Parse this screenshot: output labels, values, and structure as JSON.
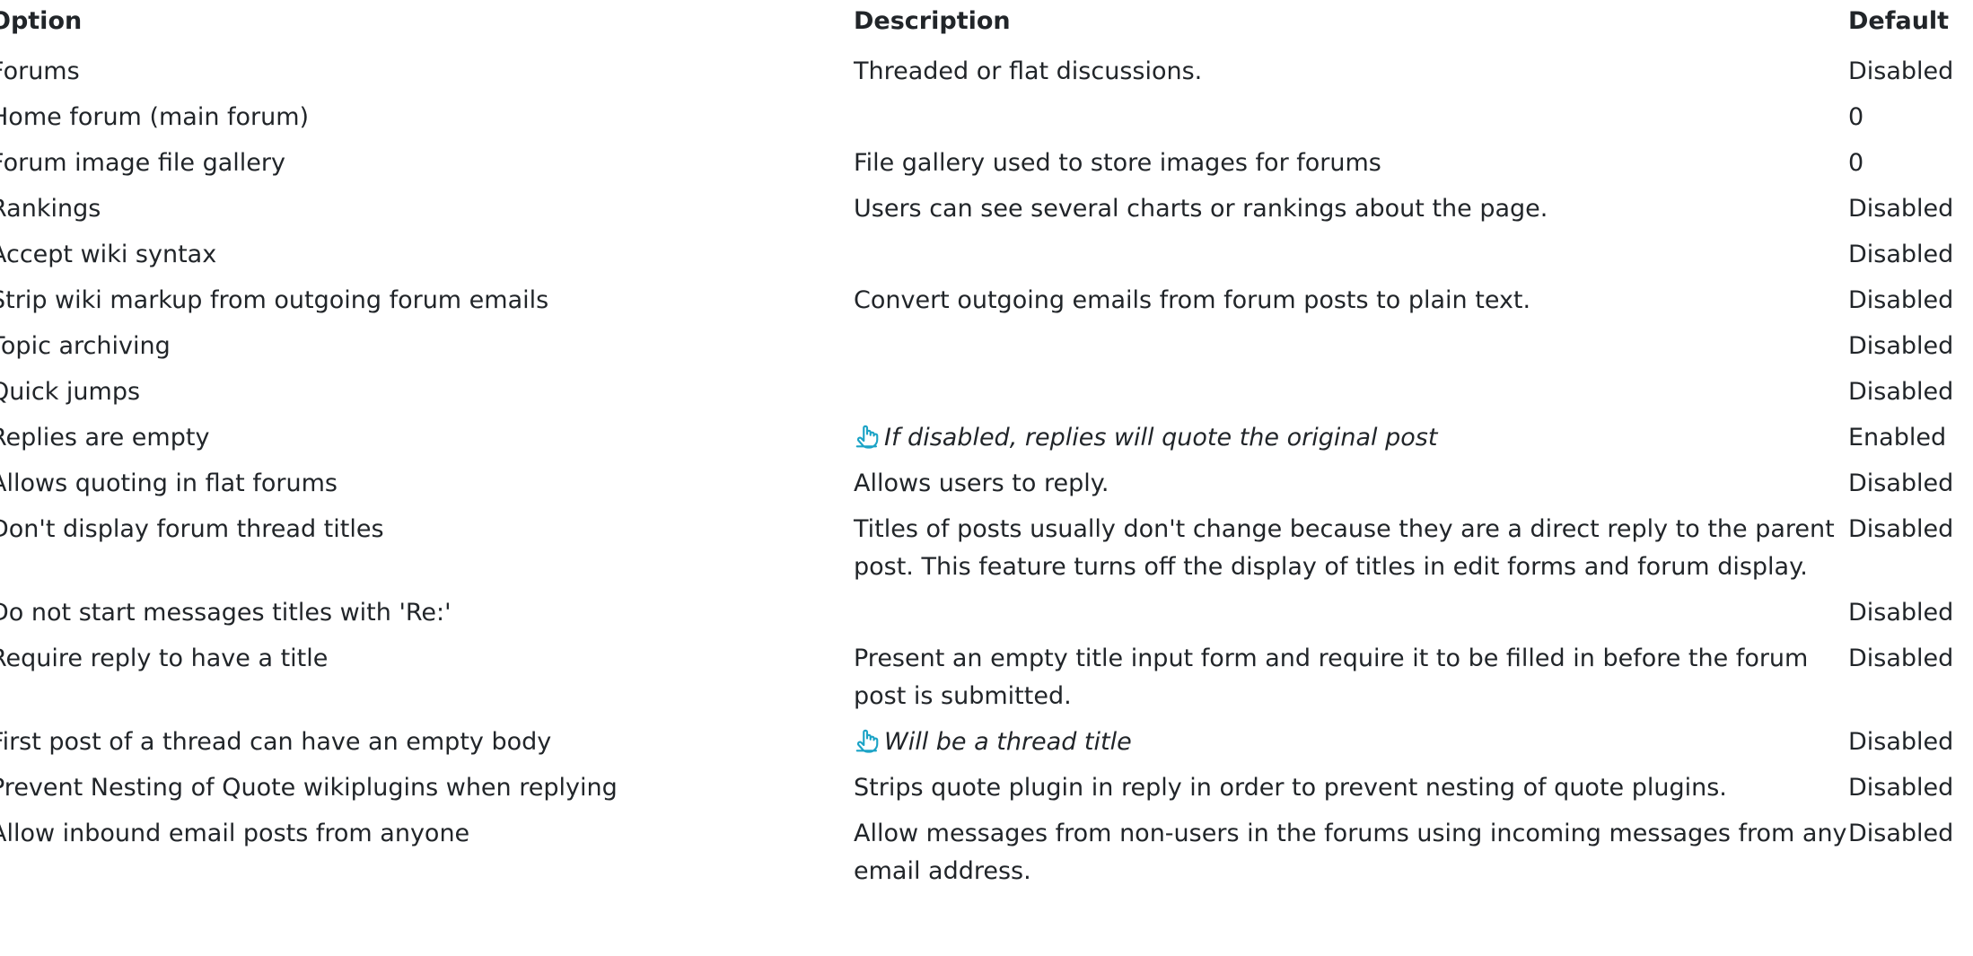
{
  "table": {
    "headers": {
      "option": "Option",
      "description": "Description",
      "default": "Default"
    },
    "rows": [
      {
        "option": "Forums",
        "description": "Threaded or flat discussions.",
        "hint": "",
        "default": "Disabled"
      },
      {
        "option": "Home forum (main forum)",
        "description": "",
        "hint": "",
        "default": "0"
      },
      {
        "option": "Forum image file gallery",
        "description": "File gallery used to store images for forums",
        "hint": "",
        "default": "0"
      },
      {
        "option": "Rankings",
        "description": "Users can see several charts or rankings about the page.",
        "hint": "",
        "default": "Disabled"
      },
      {
        "option": "Accept wiki syntax",
        "description": "",
        "hint": "",
        "default": "Disabled"
      },
      {
        "option": "Strip wiki markup from outgoing forum emails",
        "description": "Convert outgoing emails from forum posts to plain text.",
        "hint": "",
        "default": "Disabled"
      },
      {
        "option": "Topic archiving",
        "description": "",
        "hint": "",
        "default": "Disabled"
      },
      {
        "option": "Quick jumps",
        "description": "",
        "hint": "",
        "default": "Disabled"
      },
      {
        "option": "Replies are empty",
        "description": "",
        "hint": "If disabled, replies will quote the original post",
        "default": "Enabled"
      },
      {
        "option": "Allows quoting in flat forums",
        "description": "Allows users to reply.",
        "hint": "",
        "default": "Disabled"
      },
      {
        "option": "Don't display forum thread titles",
        "description": "Titles of posts usually don't change because they are a direct reply to the parent post. This feature turns off the display of titles in edit forms and forum display.",
        "hint": "",
        "default": "Disabled"
      },
      {
        "option": "Do not start messages titles with 'Re:'",
        "description": "",
        "hint": "",
        "default": "Disabled"
      },
      {
        "option": "Require reply to have a title",
        "description": "Present an empty title input form and require it to be filled in before the forum post is submitted.",
        "hint": "",
        "default": "Disabled"
      },
      {
        "option": "First post of a thread can have an empty body",
        "description": "",
        "hint": "Will be a thread title",
        "default": "Disabled"
      },
      {
        "option": "Prevent Nesting of Quote wikiplugins when replying",
        "description": "Strips quote plugin in reply in order to prevent nesting of quote plugins.",
        "hint": "",
        "default": "Disabled"
      },
      {
        "option": "Allow inbound email posts from anyone",
        "description": "Allow messages from non-users in the forums using incoming messages from any email address.",
        "hint": "",
        "default": "Disabled"
      }
    ]
  },
  "colors": {
    "text": "#212529",
    "hint_icon": "#1ba3c6"
  },
  "icons": {
    "hint": "pointing-hand-icon"
  }
}
